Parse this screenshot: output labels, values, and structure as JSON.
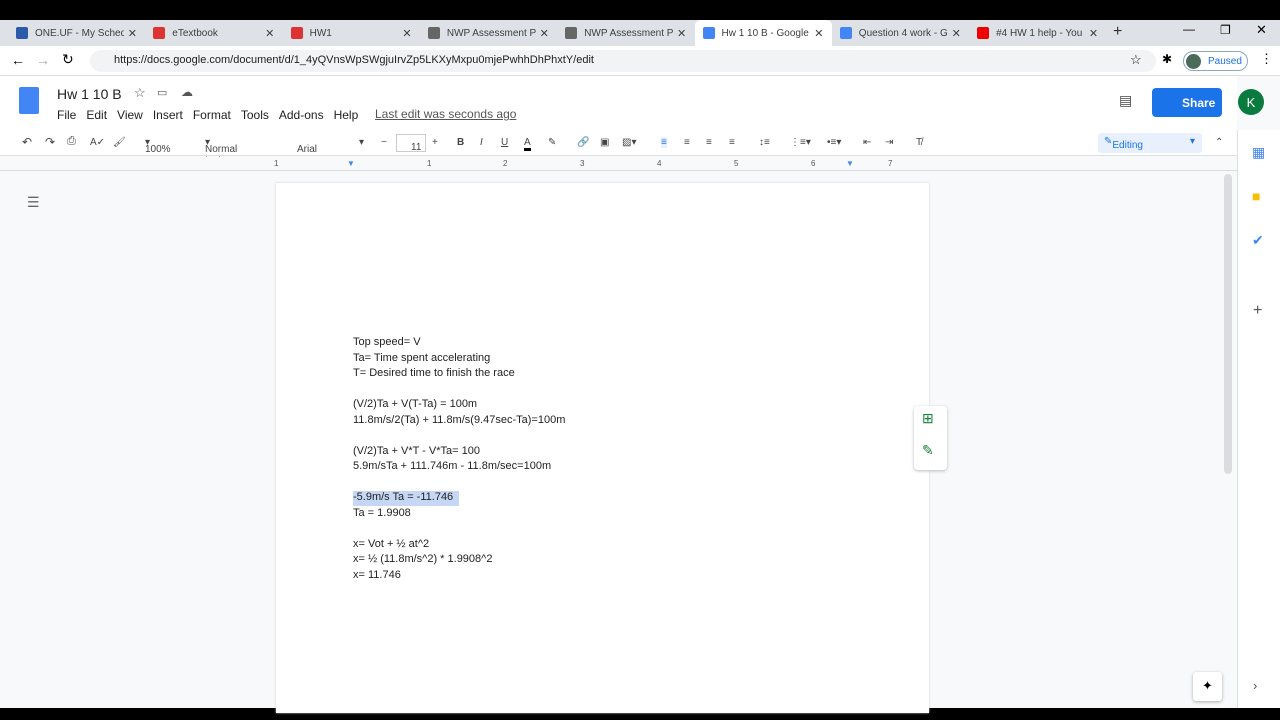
{
  "browser": {
    "tabs": [
      {
        "title": "ONE.UF - My Schedu",
        "color": "#2a5aa8"
      },
      {
        "title": "eTextbook",
        "color": "#d33"
      },
      {
        "title": "HW1",
        "color": "#d33"
      },
      {
        "title": "NWP Assessment Pl",
        "color": "#666"
      },
      {
        "title": "NWP Assessment Pl",
        "color": "#666"
      },
      {
        "title": "Hw 1 10 B - Google",
        "color": "#4285f4",
        "active": true
      },
      {
        "title": "Question 4 work - G",
        "color": "#4285f4"
      },
      {
        "title": "#4 HW 1 help - You",
        "color": "#e00"
      }
    ],
    "url": "https://docs.google.com/document/d/1_4yQVnsWpSWgjuIrvZp5LKXyMxpu0mjePwhhDhPhxtY/edit",
    "profile": "Paused"
  },
  "doc": {
    "title": "Hw 1 10 B",
    "menu": [
      "File",
      "Edit",
      "View",
      "Insert",
      "Format",
      "Tools",
      "Add-ons",
      "Help"
    ],
    "last_edit": "Last edit was seconds ago",
    "share": "Share",
    "avatar": "K"
  },
  "toolbar": {
    "zoom": "100%",
    "style": "Normal text",
    "font": "Arial",
    "size": "11",
    "mode": "Editing"
  },
  "ruler": [
    "1",
    "1",
    "2",
    "3",
    "4",
    "5",
    "6",
    "7"
  ],
  "content": [
    "Top speed= V",
    "Ta= Time spent accelerating",
    "T= Desired time to finish the race",
    "",
    "(V/2)Ta + V(T-Ta) = 100m",
    "11.8m/s/2(Ta) + 11.8m/s(9.47sec-Ta)=100m",
    "",
    "(V/2)Ta + V*T - V*Ta= 100",
    "5.9m/sTa + 111.746m - 11.8m/sec=100m",
    "",
    "-5.9m/s Ta = -11.746",
    "Ta = 1.9908",
    "",
    "x= Vot + ½ at^2",
    "x= ½ (11.8m/s^2) * 1.9908^2",
    "x= 11.746"
  ],
  "selected_line": "-5.9m/s Ta = -11.746"
}
